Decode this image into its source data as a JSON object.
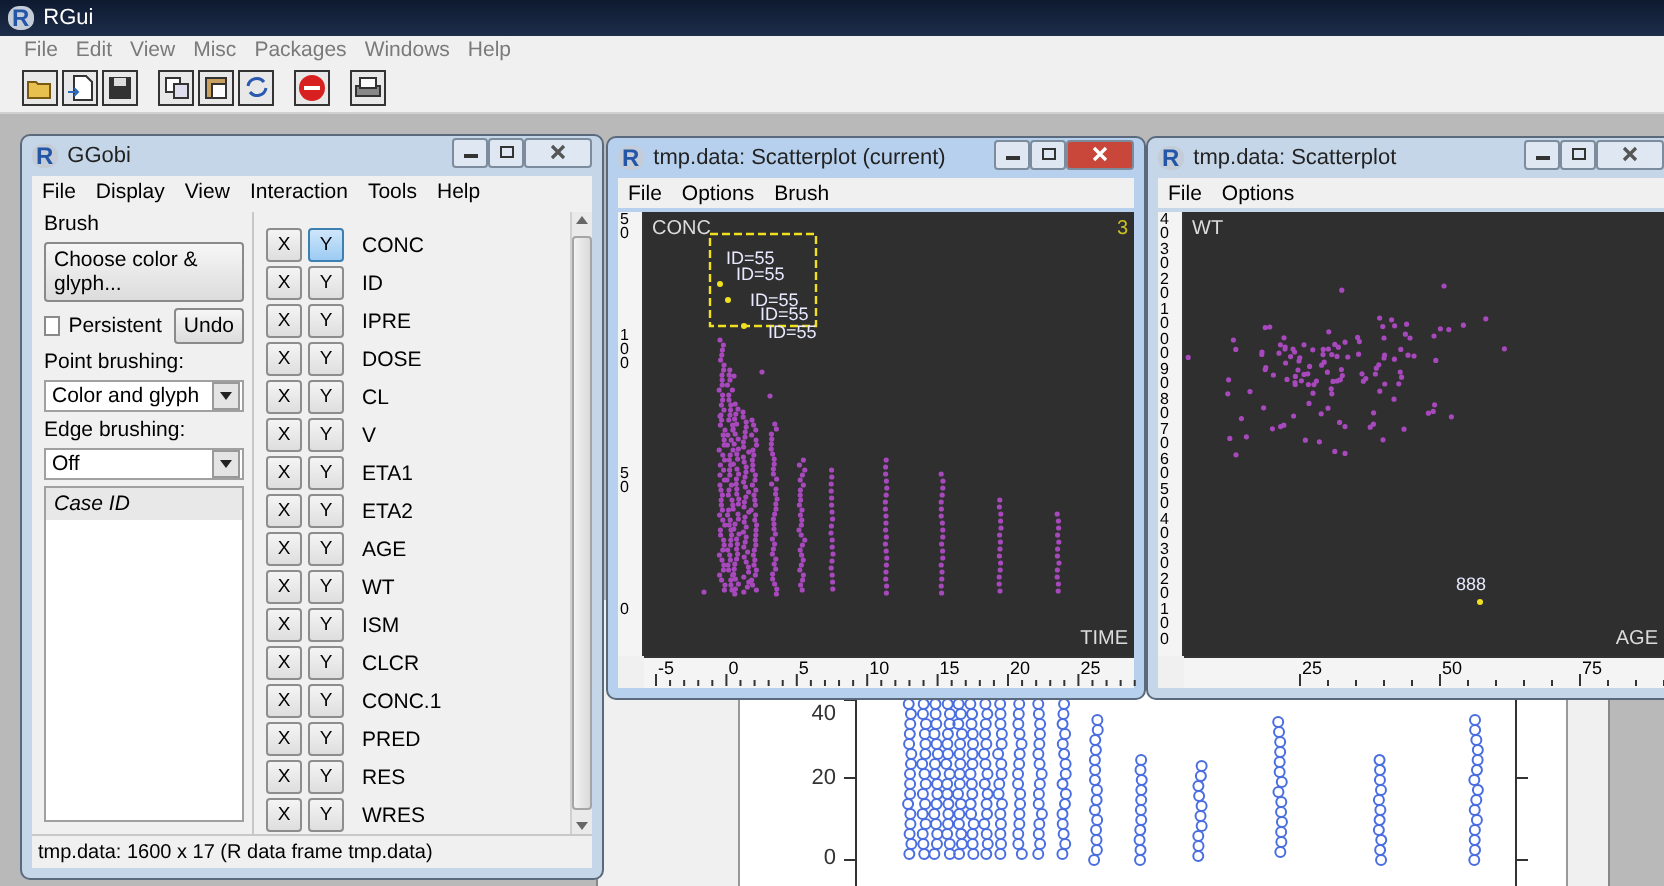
{
  "app_window": {
    "logo": "R",
    "title": "RGui"
  },
  "menu": [
    "File",
    "Edit",
    "View",
    "Misc",
    "Packages",
    "Windows",
    "Help"
  ],
  "ggobi": {
    "logo": "R",
    "title": "GGobi",
    "menu": [
      "File",
      "Display",
      "View",
      "Interaction",
      "Tools",
      "Help"
    ],
    "brush_label": "Brush",
    "choose_button": "Choose color & glyph...",
    "persistent": {
      "label": "Persistent",
      "checked": false
    },
    "undo_button": "Undo",
    "point_brushing": {
      "label": "Point brushing:",
      "value": "Color and glyph"
    },
    "edge_brushing": {
      "label": "Edge brushing:",
      "value": "Off"
    },
    "case_list": {
      "header": "Case ID"
    },
    "variables": [
      {
        "name": "CONC",
        "x": {
          "label": "X",
          "selected": false
        },
        "y": {
          "label": "Y",
          "selected": true
        }
      },
      {
        "name": "ID",
        "x": {
          "label": "X",
          "selected": false
        },
        "y": {
          "label": "Y",
          "selected": false
        }
      },
      {
        "name": "IPRE",
        "x": {
          "label": "X",
          "selected": false
        },
        "y": {
          "label": "Y",
          "selected": false
        }
      },
      {
        "name": "DOSE",
        "x": {
          "label": "X",
          "selected": false
        },
        "y": {
          "label": "Y",
          "selected": false
        }
      },
      {
        "name": "CL",
        "x": {
          "label": "X",
          "selected": false
        },
        "y": {
          "label": "Y",
          "selected": false
        }
      },
      {
        "name": "V",
        "x": {
          "label": "X",
          "selected": false
        },
        "y": {
          "label": "Y",
          "selected": false
        }
      },
      {
        "name": "ETA1",
        "x": {
          "label": "X",
          "selected": false
        },
        "y": {
          "label": "Y",
          "selected": false
        }
      },
      {
        "name": "ETA2",
        "x": {
          "label": "X",
          "selected": false
        },
        "y": {
          "label": "Y",
          "selected": false
        }
      },
      {
        "name": "AGE",
        "x": {
          "label": "X",
          "selected": false
        },
        "y": {
          "label": "Y",
          "selected": false
        }
      },
      {
        "name": "WT",
        "x": {
          "label": "X",
          "selected": false
        },
        "y": {
          "label": "Y",
          "selected": false
        }
      },
      {
        "name": "ISM",
        "x": {
          "label": "X",
          "selected": false
        },
        "y": {
          "label": "Y",
          "selected": false
        }
      },
      {
        "name": "CLCR",
        "x": {
          "label": "X",
          "selected": false
        },
        "y": {
          "label": "Y",
          "selected": false
        }
      },
      {
        "name": "CONC.1",
        "x": {
          "label": "X",
          "selected": false
        },
        "y": {
          "label": "Y",
          "selected": false
        }
      },
      {
        "name": "PRED",
        "x": {
          "label": "X",
          "selected": false
        },
        "y": {
          "label": "Y",
          "selected": false
        }
      },
      {
        "name": "RES",
        "x": {
          "label": "X",
          "selected": false
        },
        "y": {
          "label": "Y",
          "selected": false
        }
      },
      {
        "name": "WRES",
        "x": {
          "label": "X",
          "selected": false
        },
        "y": {
          "label": "Y",
          "selected": false
        }
      }
    ],
    "status": "tmp.data: 1600 x 17 (R data frame tmp.data)"
  },
  "scatterplots": [
    {
      "kind": "time",
      "logo": "R",
      "title": "tmp.data: Scatterplot (current)",
      "active": true,
      "menu": [
        "File",
        "Options",
        "Brush"
      ],
      "y_label": "CONC",
      "x_label": "TIME",
      "count": "3",
      "point_labels": [
        "ID=55",
        "ID=55",
        "ID=55",
        "ID=55",
        "ID=55"
      ],
      "x_ruler": [
        "-5",
        "0",
        "5",
        "10",
        "15",
        "20",
        "25"
      ],
      "y_ruler": [
        "50",
        "100",
        "50",
        "0"
      ]
    },
    {
      "kind": "cloud",
      "logo": "R",
      "title": "tmp.data: Scatterplot",
      "active": false,
      "menu": [
        "File",
        "Options"
      ],
      "y_label": "WT",
      "x_label": "AGE",
      "point_labels": [
        "888"
      ],
      "x_ruler": [
        "25",
        "50",
        "75"
      ],
      "y_ruler": [
        "40",
        "30",
        "20",
        "10",
        "00",
        "90",
        "80",
        "70",
        "60",
        "50",
        "40",
        "30",
        "20",
        "10",
        "0"
      ]
    }
  ],
  "graphics_window": {
    "y_ticks": [
      "40",
      "20",
      "0"
    ]
  }
}
